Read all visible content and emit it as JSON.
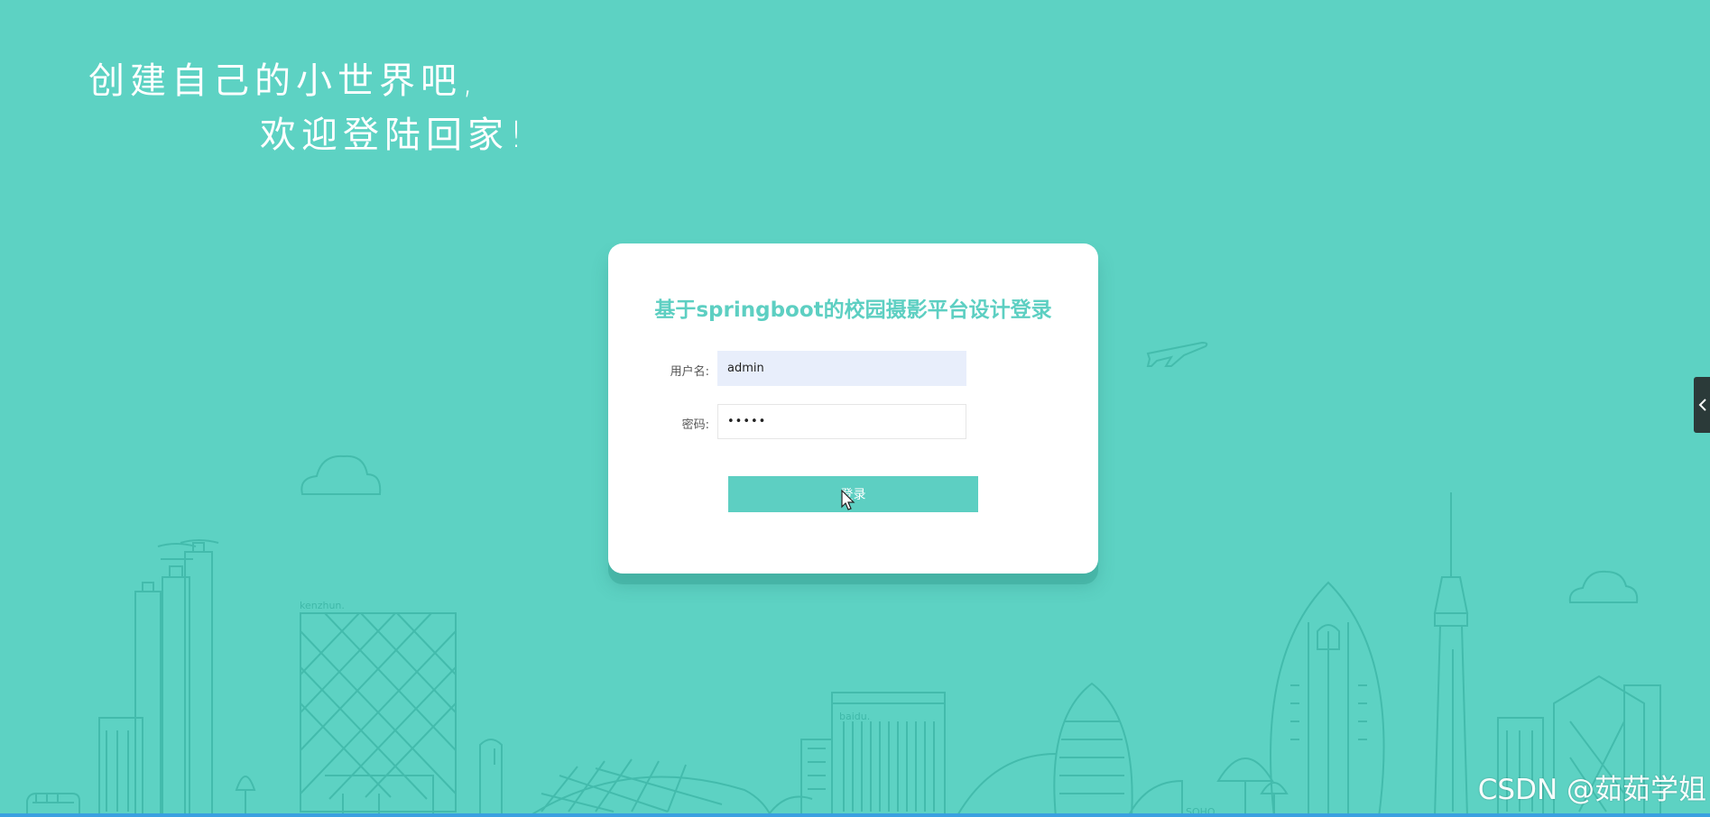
{
  "slogan": {
    "line1": "创建自己的小世界吧,",
    "line2": "欢迎登陆回家!"
  },
  "login_card": {
    "title": "基于springboot的校园摄影平台设计登录",
    "username_label": "用户名:",
    "username_value": "admin",
    "password_label": "密码:",
    "password_value": "•••••",
    "login_button": "登录"
  },
  "skyline": {
    "building_labels": [
      "kenzhun.",
      "baidu.",
      "SOHO"
    ]
  },
  "side_tab": {
    "icon": "chevron-left-icon"
  },
  "watermark": "CSDN @茹茹学姐",
  "colors": {
    "background": "#5dd2c3",
    "accent": "#5dcfc2",
    "line_art": "#3fb8a8",
    "username_fill": "#e8eefb"
  }
}
